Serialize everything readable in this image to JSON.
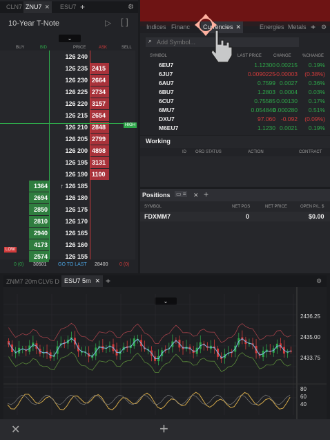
{
  "colors": {
    "up": "#2ea84a",
    "down": "#d23b3b",
    "bg": "#1b1c1f",
    "panel": "#222327",
    "overlay": "#7a1717"
  },
  "ladder": {
    "tabs": [
      "CLN7",
      "ZNU7",
      "ESU7"
    ],
    "title": "10-Year T-Note",
    "headers": {
      "buy": "BUY",
      "bid": "BID",
      "price": "PRICE",
      "ask": "ASK",
      "sell": "SELL"
    },
    "high_badge": "HIGH",
    "low_badge": "LOW",
    "rows": [
      {
        "price": "126 240",
        "ask": "",
        "bid": ""
      },
      {
        "price": "126 235",
        "ask": "2415",
        "bid": ""
      },
      {
        "price": "126 230",
        "ask": "2664",
        "bid": ""
      },
      {
        "price": "126 225",
        "ask": "2734",
        "bid": ""
      },
      {
        "price": "126 220",
        "ask": "3157",
        "bid": ""
      },
      {
        "price": "126 215",
        "ask": "2654",
        "bid": ""
      },
      {
        "price": "126 210",
        "ask": "2848",
        "bid": ""
      },
      {
        "price": "126 205",
        "ask": "2799",
        "bid": ""
      },
      {
        "price": "126 200",
        "ask": "4898",
        "bid": ""
      },
      {
        "price": "126 195",
        "ask": "3131",
        "bid": ""
      },
      {
        "price": "126 190",
        "ask": "1100",
        "bid": ""
      },
      {
        "price": "↑ 126 185",
        "ask": "",
        "bid": "1364"
      },
      {
        "price": "126 180",
        "ask": "",
        "bid": "2694"
      },
      {
        "price": "126 175",
        "ask": "",
        "bid": "2850"
      },
      {
        "price": "126 170",
        "ask": "",
        "bid": "2810"
      },
      {
        "price": "126 165",
        "ask": "",
        "bid": "2940"
      },
      {
        "price": "126 160",
        "ask": "",
        "bid": "4173"
      },
      {
        "price": "126 155",
        "ask": "",
        "bid": "2574"
      }
    ],
    "footer": {
      "buy": "0 (0)",
      "bid": "30501",
      "go": "GO TO LAST",
      "ask": "28400",
      "sell": "0 (0)"
    }
  },
  "watchlist": {
    "tabs": [
      "Indices",
      "Financ",
      "Currencies",
      "Energies",
      "Metals"
    ],
    "search_placeholder": "Add Symbol...",
    "headers": {
      "symbol": "SYMBOL",
      "last": "LAST PRICE",
      "change": "CHANGE",
      "pchange": "%CHANGE"
    },
    "rows": [
      {
        "sym": "6EU7",
        "last": "1.12300",
        "chg": "0.00215",
        "pct": "0.19%",
        "dir": "up"
      },
      {
        "sym": "6JU7",
        "last": "0.0090225",
        "chg": "-0.00003",
        "pct": "(0.38%)",
        "dir": "down"
      },
      {
        "sym": "6AU7",
        "last": "0.7599",
        "chg": "0.0027",
        "pct": "0.36%",
        "dir": "up"
      },
      {
        "sym": "6BU7",
        "last": "1.2803",
        "chg": "0.0004",
        "pct": "0.03%",
        "dir": "up"
      },
      {
        "sym": "6CU7",
        "last": "0.75585",
        "chg": "0.00130",
        "pct": "0.17%",
        "dir": "up"
      },
      {
        "sym": "6MU7",
        "last": "0.054840",
        "chg": "0.000280",
        "pct": "0.51%",
        "dir": "up"
      },
      {
        "sym": "DXU7",
        "last": "97.060",
        "chg": "-0.092",
        "pct": "(0.09%)",
        "dir": "down"
      },
      {
        "sym": "M6EU7",
        "last": "1.1230",
        "chg": "0.0021",
        "pct": "0.19%",
        "dir": "up"
      }
    ]
  },
  "working": {
    "title": "Working",
    "headers": {
      "id": "ID",
      "status": "ORD STATUS",
      "action": "ACTION",
      "contract": "CONTRACT"
    }
  },
  "positions": {
    "title": "Positions",
    "headers": {
      "symbol": "SYMBOL",
      "netpos": "NET POS",
      "netprice": "NET PRICE",
      "openpl": "OPEN P/L, $"
    },
    "rows": [
      {
        "sym": "FDXMM7",
        "netpos": "0",
        "netprice": "",
        "openpl": "$0.00"
      }
    ]
  },
  "chartpanel": {
    "tabs": [
      "ZNM7 20m",
      "CLV6 D",
      "ESU7 5m"
    ],
    "price_labels": [
      "2436.25",
      "2435.00",
      "2433.75"
    ],
    "osc_labels": [
      "80",
      "60",
      "40"
    ]
  },
  "bottom": {
    "close": "✕",
    "add": "+"
  }
}
